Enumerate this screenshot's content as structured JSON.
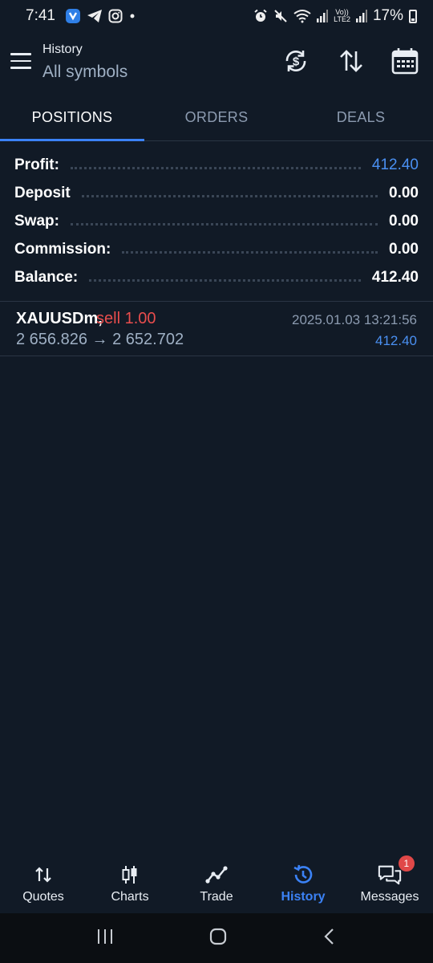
{
  "status_bar": {
    "time": "7:41",
    "battery": "17%",
    "icons": [
      "app-notification-icon",
      "telegram-icon",
      "instagram-icon",
      "dot-icon",
      "alarm-icon",
      "mute-icon",
      "wifi-icon",
      "signal-icon",
      "volte-icon",
      "signal-icon",
      "battery-icon"
    ],
    "volte": "Vo)) LTE2"
  },
  "header": {
    "title": "History",
    "subtitle": "All symbols",
    "icons": [
      "menu-icon",
      "currency-refresh-icon",
      "sort-icon",
      "calendar-icon"
    ]
  },
  "tabs": [
    {
      "label": "POSITIONS",
      "active": true
    },
    {
      "label": "ORDERS",
      "active": false
    },
    {
      "label": "DEALS",
      "active": false
    }
  ],
  "summary": [
    {
      "label": "Profit:",
      "value": "412.40",
      "highlight": true
    },
    {
      "label": "Deposit",
      "value": "0.00",
      "highlight": false
    },
    {
      "label": "Swap:",
      "value": "0.00",
      "highlight": false
    },
    {
      "label": "Commission:",
      "value": "0.00",
      "highlight": false
    },
    {
      "label": "Balance:",
      "value": "412.40",
      "highlight": false
    }
  ],
  "positions": [
    {
      "symbol": "XAUUSDm,",
      "side": "sell 1.00",
      "prices": "2 656.826 → 2 652.702",
      "datetime": "2025.01.03 13:21:56",
      "profit": "412.40"
    }
  ],
  "bottom_nav": [
    {
      "label": "Quotes",
      "icon": "quotes-icon",
      "active": false
    },
    {
      "label": "Charts",
      "icon": "charts-icon",
      "active": false
    },
    {
      "label": "Trade",
      "icon": "trade-icon",
      "active": false
    },
    {
      "label": "History",
      "icon": "history-icon",
      "active": true
    },
    {
      "label": "Messages",
      "icon": "messages-icon",
      "active": false,
      "badge": "1"
    }
  ],
  "colors": {
    "background": "#111a26",
    "accent": "#3b82f6",
    "profit_blue": "#4a90f2",
    "sell_red": "#e84d4d",
    "muted": "#8c9bb0"
  }
}
